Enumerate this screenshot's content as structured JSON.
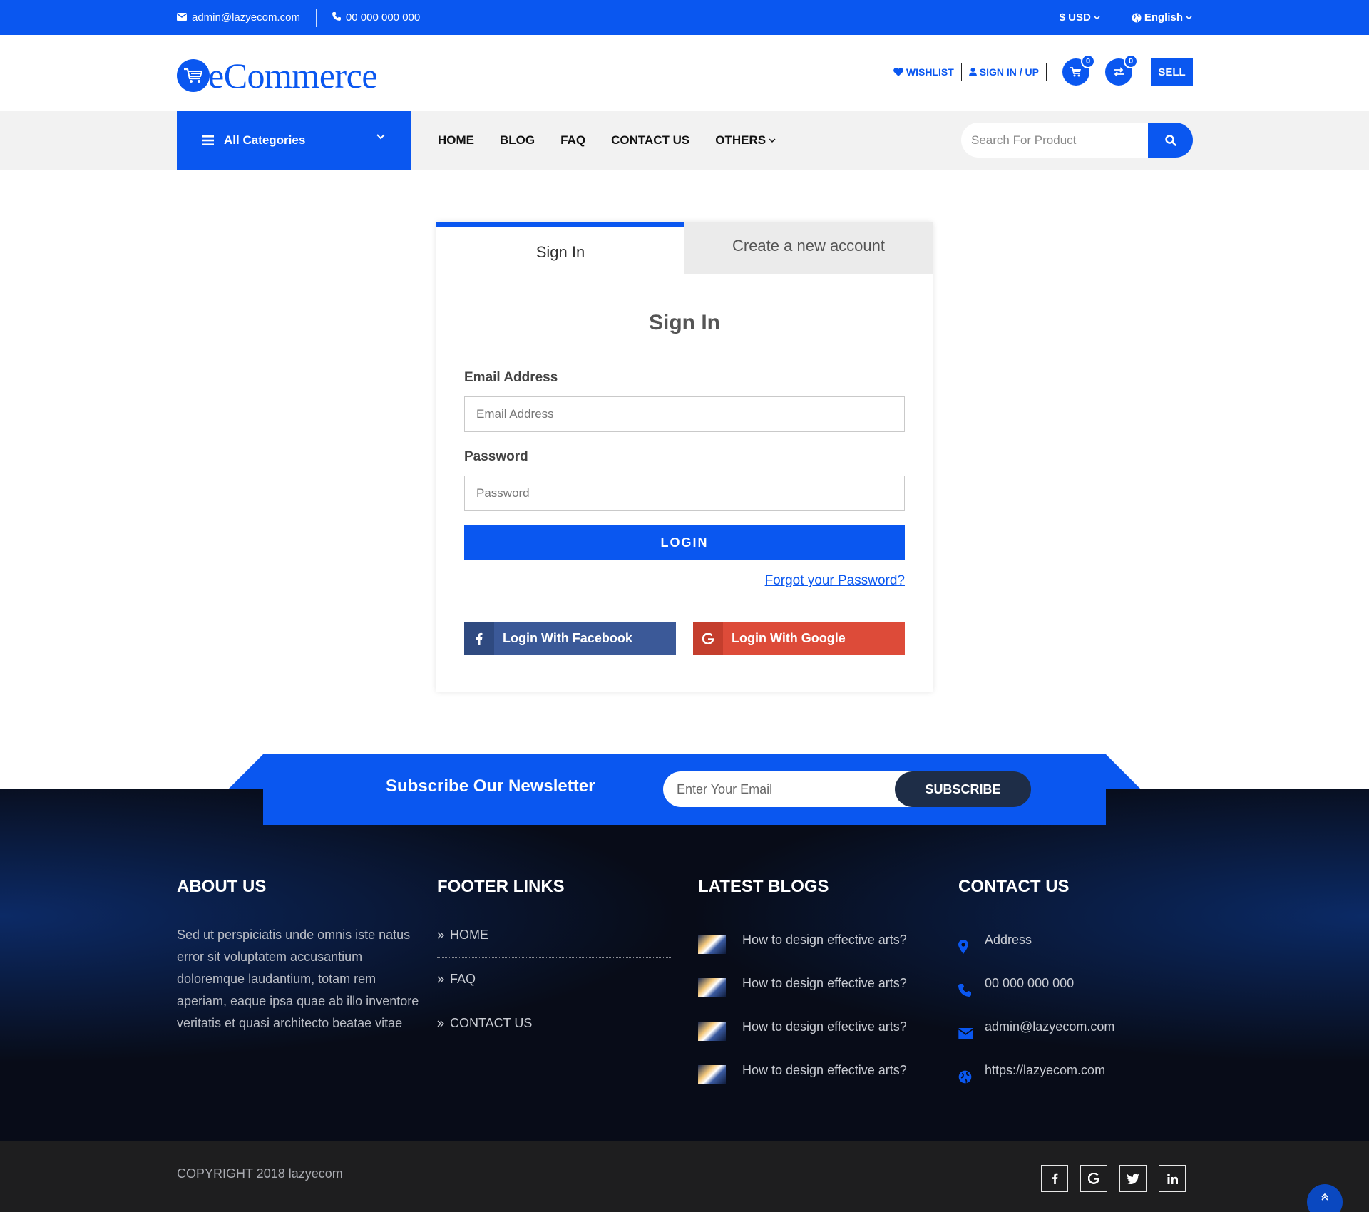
{
  "topbar": {
    "email": "admin@lazyecom.com",
    "phone": "00 000 000 000",
    "currency": "$ USD",
    "language": "English"
  },
  "header": {
    "logo_text": "eCommerce",
    "wishlist": "WISHLIST",
    "signin": "SIGN IN / UP",
    "cart_count": "0",
    "compare_count": "0",
    "sell": "SELL"
  },
  "nav": {
    "all_categories": "All Categories",
    "links": [
      "HOME",
      "BLOG",
      "FAQ",
      "CONTACT US",
      "OTHERS"
    ],
    "search_placeholder": "Search For Product"
  },
  "auth": {
    "tab_signin": "Sign In",
    "tab_create": "Create a new account",
    "title": "Sign In",
    "email_label": "Email Address",
    "email_placeholder": "Email Address",
    "password_label": "Password",
    "password_placeholder": "Password",
    "login_button": "LOGIN",
    "forgot": "Forgot your Password?",
    "facebook": "Login With Facebook",
    "google": "Login With Google"
  },
  "newsletter": {
    "title": "Subscribe Our Newsletter",
    "placeholder": "Enter Your Email",
    "button": "SUBSCRIBE"
  },
  "footer": {
    "about_title": "ABOUT US",
    "about_text": "Sed ut perspiciatis unde omnis iste natus error sit voluptatem accusantium doloremque laudantium, totam rem aperiam, eaque ipsa quae ab illo inventore veritatis et quasi architecto beatae vitae",
    "links_title": "FOOTER LINKS",
    "links": [
      "HOME",
      "FAQ",
      "CONTACT US"
    ],
    "blogs_title": "LATEST BLOGS",
    "blogs": [
      "How to design effective arts?",
      "How to design effective arts?",
      "How to design effective arts?",
      "How to design effective arts?"
    ],
    "contact_title": "CONTACT US",
    "contact": {
      "address": "Address",
      "phone": "00 000 000 000",
      "email": "admin@lazyecom.com",
      "website": "https://lazyecom.com"
    },
    "copyright": "COPYRIGHT 2018 lazyecom"
  },
  "colors": {
    "primary": "#0a57f0",
    "facebook": "#3b5998",
    "google": "#dd4b39",
    "footer_bg": "#080c18"
  }
}
